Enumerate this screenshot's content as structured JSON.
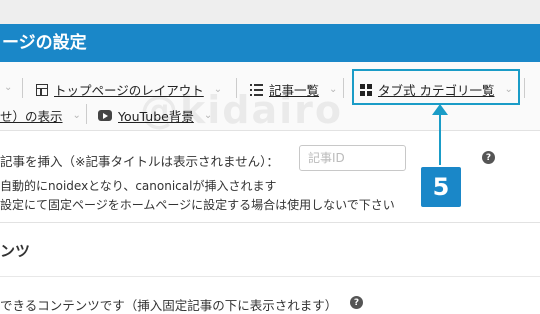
{
  "header": {
    "title": "ージの設定"
  },
  "tabs": {
    "row1": [
      {
        "label": "トップページのレイアウト",
        "icon": "layout-icon"
      },
      {
        "label": "記事一覧",
        "icon": "list-icon"
      },
      {
        "label": "タブ式 カテゴリ一覧",
        "icon": "grid-icon"
      }
    ],
    "row2": [
      {
        "label": "せ）の表示"
      },
      {
        "label": "YouTube背景",
        "icon": "youtube-icon"
      }
    ]
  },
  "callout": {
    "number": "5",
    "color": "#1a9cc7"
  },
  "form": {
    "insert_article_label": "記事を挿入（※記事タイトルは表示されません）：",
    "article_id_placeholder": "記事ID",
    "note_line1": "自動的にnoidexとなり、canonicalが挿入されます",
    "note_line2": "設定にて固定ページをホームページに設定する場合は使用しないで下さい"
  },
  "section": {
    "title": "ンツ",
    "description": "できるコンテンツです（挿入固定記事の下に表示されます）"
  },
  "watermark": "@kidairo",
  "colors": {
    "accent": "#1a87c8",
    "highlight": "#1a9cc7"
  }
}
